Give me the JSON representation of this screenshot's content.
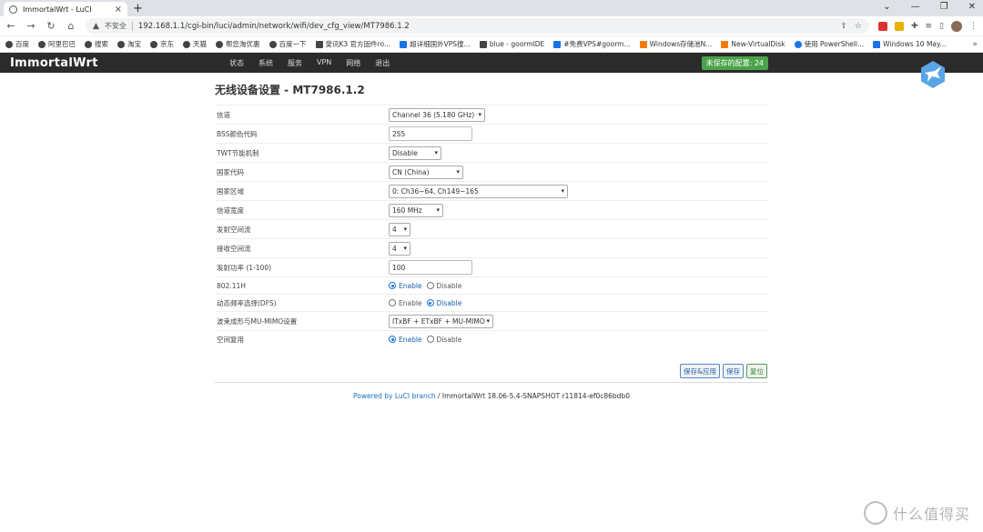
{
  "browser": {
    "tab_title": "ImmortalWrt - LuCI",
    "tab_close": "×",
    "new_tab": "+",
    "window_controls": [
      "—",
      "❐",
      "✕"
    ],
    "nav": {
      "back": "←",
      "forward": "→",
      "reload": "↻",
      "home": "⌂"
    },
    "insecure_label": "不安全",
    "url": "192.168.1.1/cgi-bin/luci/admin/network/wifi/dev_cfg_view/MT7986.1.2",
    "bookmarks": [
      {
        "label": "百度",
        "icon": "globe-icon"
      },
      {
        "label": "阿里巴巴",
        "icon": "globe-icon"
      },
      {
        "label": "搜索",
        "icon": "globe-icon"
      },
      {
        "label": "淘宝",
        "icon": "globe-icon"
      },
      {
        "label": "京东",
        "icon": "globe-icon"
      },
      {
        "label": "天猫",
        "icon": "globe-icon"
      },
      {
        "label": "帮您淘优惠",
        "icon": "globe-icon"
      },
      {
        "label": "百度一下",
        "icon": "globe-icon"
      },
      {
        "label": "斐讯K3 官方固件ro...",
        "icon": "site-icon"
      },
      {
        "label": "超详细国外VPS搜...",
        "icon": "site-icon"
      },
      {
        "label": "blue - goormIDE",
        "icon": "terminal-icon"
      },
      {
        "label": "#免费VPS#goorm...",
        "icon": "site-icon"
      },
      {
        "label": "Windows存储池N...",
        "icon": "site-icon"
      },
      {
        "label": "New-VirtualDisk",
        "icon": "microsoft-icon"
      },
      {
        "label": "使用 PowerShell...",
        "icon": "site-icon"
      },
      {
        "label": "Windows 10 May...",
        "icon": "site-icon"
      }
    ],
    "bookmarks_more": "»"
  },
  "luci": {
    "brand": "ImmortalWrt",
    "menu": [
      "状态",
      "系统",
      "服务",
      "VPN",
      "网络",
      "退出"
    ],
    "unsaved_badge": "未保存的配置: 24"
  },
  "page": {
    "title": "无线设备设置 - MT7986.1.2",
    "fields": {
      "channel": {
        "label": "信道",
        "value": "Channel 36 (5.180 GHz)"
      },
      "bss_color": {
        "label": "BSS颜色代码",
        "value": "255"
      },
      "twt": {
        "label": "TWT节能机制",
        "value": "Disable"
      },
      "country_code": {
        "label": "国家代码",
        "value": "CN (China)"
      },
      "country_region": {
        "label": "国家区域",
        "value": "0: Ch36~64, Ch149~165"
      },
      "bandwidth": {
        "label": "信道宽度",
        "value": "160 MHz"
      },
      "tx_stream": {
        "label": "发射空间流",
        "value": "4"
      },
      "rx_stream": {
        "label": "接收空间流",
        "value": "4"
      },
      "tx_power": {
        "label": "发射功率 (1-100)",
        "value": "100"
      },
      "ieee80211h": {
        "label": "802.11H",
        "enable": "Enable",
        "disable": "Disable",
        "selected": "Enable"
      },
      "dfs": {
        "label": "动态频率选择(DFS)",
        "enable": "Enable",
        "disable": "Disable",
        "selected": "Disable"
      },
      "beamforming": {
        "label": "波束成形与MU-MIMO设置",
        "value": "ITxBF + ETxBF + MU-MIMO"
      },
      "spatial_reuse": {
        "label": "空间复用",
        "enable": "Enable",
        "disable": "Disable",
        "selected": "Enable"
      }
    },
    "buttons": {
      "save_apply": "保存&应用",
      "save": "保存",
      "reset": "复位"
    },
    "footer": {
      "link": "Powered by LuCI branch",
      "rest": " / ImmortalWrt 18.06-5.4-SNAPSHOT r11814-ef0c86bdb0"
    }
  },
  "watermark": "什么值得买"
}
